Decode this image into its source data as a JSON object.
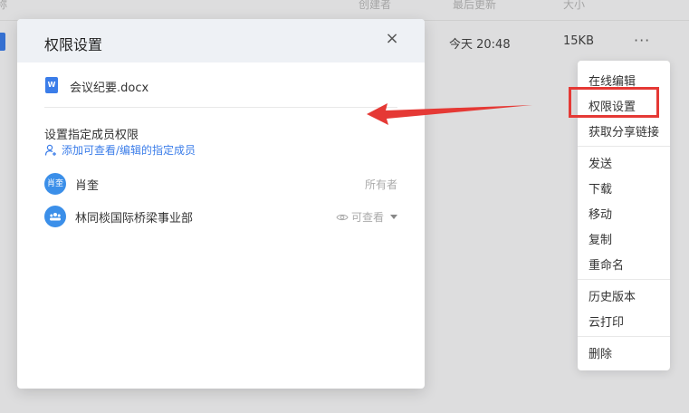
{
  "background_list": {
    "headers": [
      "称",
      "创建者",
      "最后更新",
      "大小"
    ],
    "row": {
      "updated": "今天 20:48",
      "size": "15KB",
      "more": "···"
    }
  },
  "context_menu": {
    "items": [
      "在线编辑",
      "权限设置",
      "获取分享链接",
      "发送",
      "下载",
      "移动",
      "复制",
      "重命名",
      "历史版本",
      "云打印",
      "删除"
    ],
    "highlight_color": "#e53935"
  },
  "dialog": {
    "title": "权限设置",
    "close": "×",
    "file": {
      "icon_letter": "W",
      "name": "会议纪要.docx"
    },
    "section_title": "设置指定成员权限",
    "add_member": "添加可查看/编辑的指定成员",
    "members": [
      {
        "avatar_text": "肖奎",
        "name": "肖奎",
        "role": "所有者"
      },
      {
        "avatar_text": "",
        "name": "林同棪国际桥梁事业部",
        "role": "可查看"
      }
    ]
  },
  "colors": {
    "accent": "#3b7de9",
    "annotation": "#e53935"
  }
}
